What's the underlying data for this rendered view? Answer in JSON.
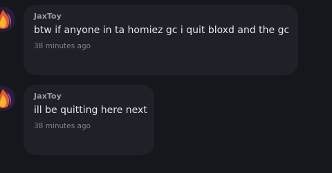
{
  "messages": [
    {
      "username": "JaxToy",
      "text": "btw if anyone in ta homiez gc i quit bloxd and the gc",
      "time": "38 minutes ago"
    },
    {
      "username": "JaxToy",
      "text": "ill be quitting here next",
      "time": "38 minutes ago"
    }
  ]
}
